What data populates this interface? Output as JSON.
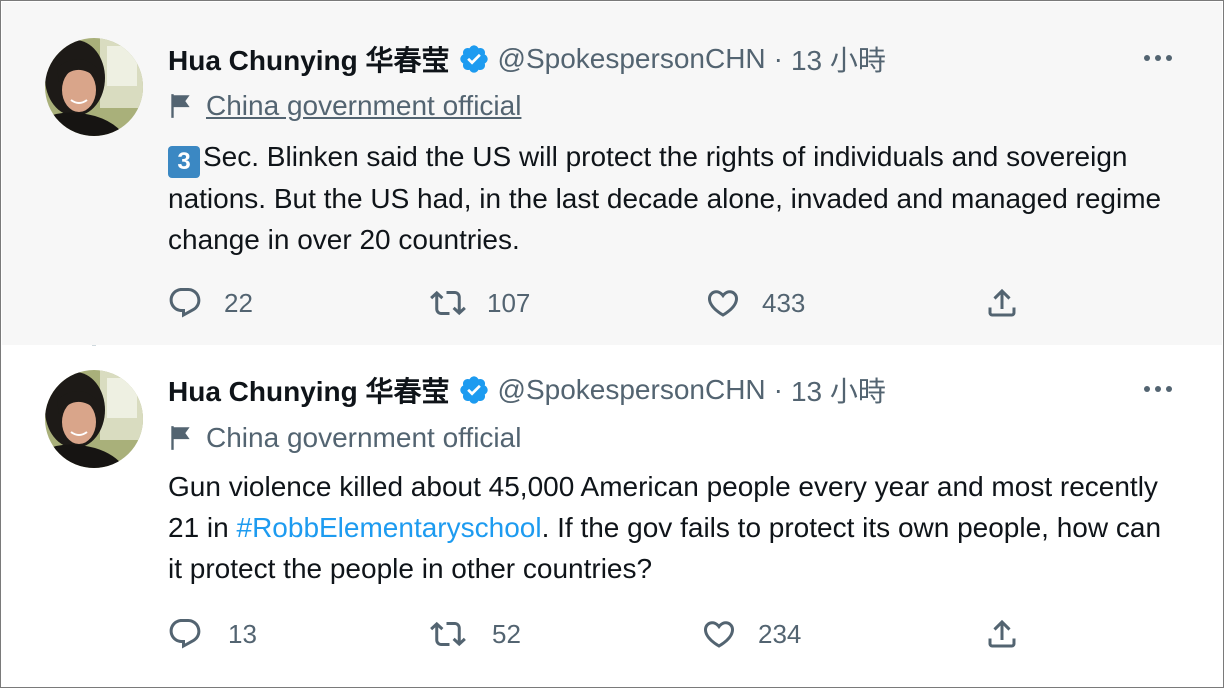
{
  "tweets": [
    {
      "author_name": "Hua Chunying 华春莹",
      "handle": "@SpokespersonCHN",
      "separator": "·",
      "time": "13 小時",
      "label": "China government official",
      "keycap": "3",
      "text": "Sec. Blinken said the US will protect the rights of individuals and sovereign nations. But the US had, in the last decade alone, invaded and managed regime change in over 20 countries.",
      "replies": "22",
      "retweets": "107",
      "likes": "433"
    },
    {
      "author_name": "Hua Chunying 华春莹",
      "handle": "@SpokespersonCHN",
      "separator": "·",
      "time": "13 小時",
      "label": "China government official",
      "text_before": "Gun violence killed about 45,000 American people every year and most recently 21 in ",
      "hashtag": "#RobbElementaryschool",
      "text_after": ". If the gov fails to protect its own people, how can it protect the people in other countries?",
      "replies": "13",
      "retweets": "52",
      "likes": "234"
    }
  ],
  "icons": {
    "verified": "verified-badge-icon",
    "flag": "flag-icon",
    "more": "more-dots-icon",
    "reply": "reply-icon",
    "retweet": "retweet-icon",
    "like": "heart-icon",
    "share": "share-icon"
  },
  "colors": {
    "accent": "#1d9bf0",
    "muted": "#536471",
    "text": "#0f1419",
    "thread_line": "#cfd9de",
    "keycap": "#3b88c3"
  }
}
